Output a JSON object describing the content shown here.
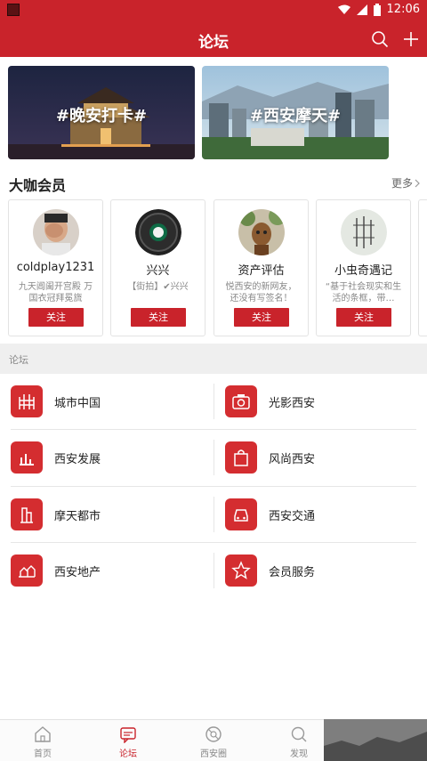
{
  "status": {
    "time": "12:06"
  },
  "header": {
    "title": "论坛"
  },
  "banners": [
    {
      "text": "#晚安打卡#"
    },
    {
      "text": "#西安摩天#"
    }
  ],
  "vip": {
    "title": "大咖会员",
    "more": "更多",
    "follow_label": "关注",
    "members": [
      {
        "name": "coldplay1231",
        "desc": "九天阊阖开宫殿 万国衣冠拜冕旒"
      },
      {
        "name": "兴兴",
        "desc": "【街拍】✔兴兴"
      },
      {
        "name": "资产评估",
        "desc": "悦西安的新网友，还没有写签名！"
      },
      {
        "name": "小虫奇遇记",
        "desc": "“基于社会现实和生活的条框，带…"
      }
    ]
  },
  "forum": {
    "label": "论坛",
    "items": [
      {
        "name": "城市中国",
        "icon": "city-icon"
      },
      {
        "name": "光影西安",
        "icon": "camera-icon"
      },
      {
        "name": "西安发展",
        "icon": "chart-icon"
      },
      {
        "name": "风尚西安",
        "icon": "shopping-bag-icon"
      },
      {
        "name": "摩天都市",
        "icon": "skyscraper-icon"
      },
      {
        "name": "西安交通",
        "icon": "car-icon"
      },
      {
        "name": "西安地产",
        "icon": "building-icon"
      },
      {
        "name": "会员服务",
        "icon": "star-icon"
      }
    ]
  },
  "nav": {
    "items": [
      {
        "label": "首页",
        "icon": "home-icon"
      },
      {
        "label": "论坛",
        "icon": "forum-icon"
      },
      {
        "label": "西安圈",
        "icon": "circle-icon"
      },
      {
        "label": "发现",
        "icon": "discover-icon"
      }
    ],
    "active": 1
  },
  "colors": {
    "primary": "#c9232b",
    "icon_bg": "#d42d30"
  }
}
